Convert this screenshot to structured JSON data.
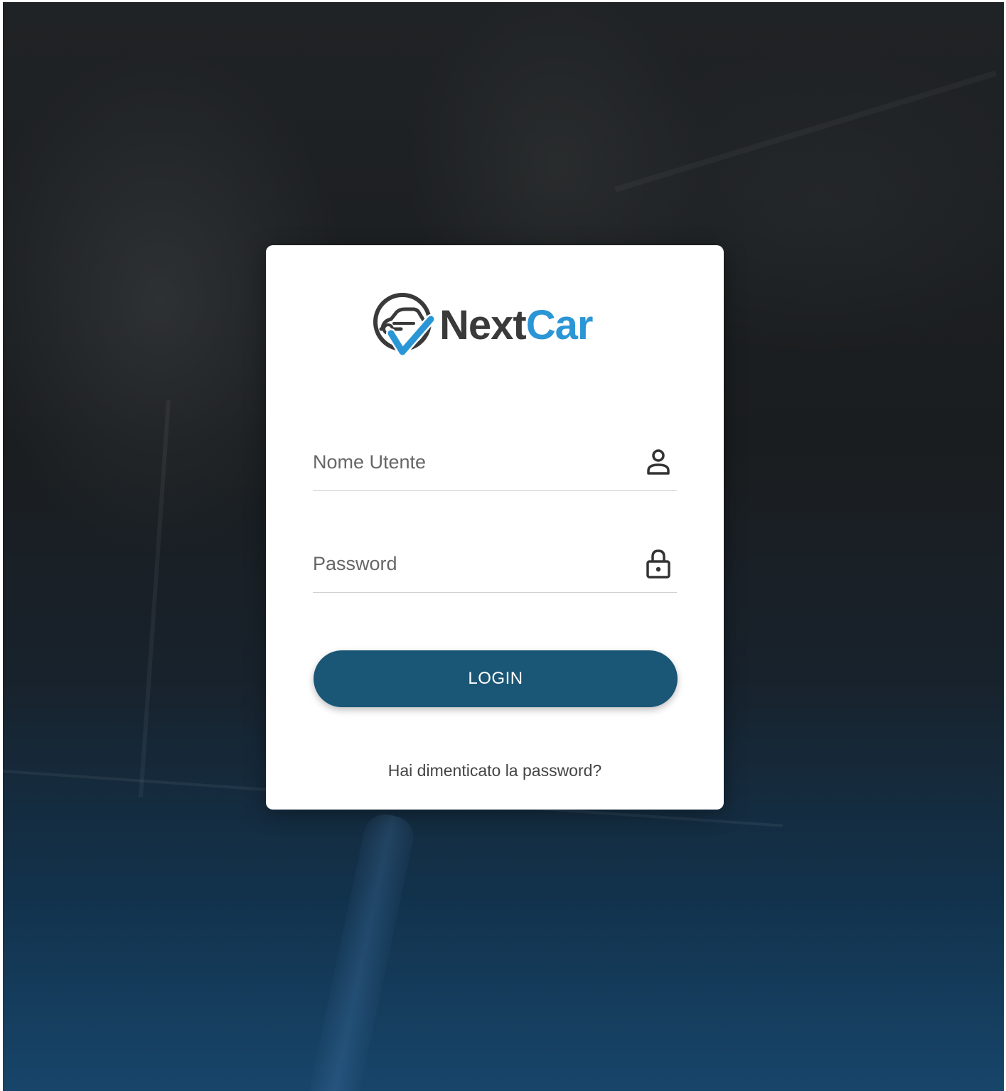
{
  "brand": {
    "name_part1": "Next",
    "name_part2": "Car",
    "color_dark": "#3a3a3a",
    "color_accent": "#2b96d6"
  },
  "form": {
    "username_placeholder": "Nome Utente",
    "username_value": "",
    "username_icon": "user-icon",
    "password_placeholder": "Password",
    "password_value": "",
    "password_icon": "lock-icon",
    "login_label": "LOGIN",
    "login_color": "#1a5675",
    "forgot_label": "Hai dimenticato la password?"
  }
}
